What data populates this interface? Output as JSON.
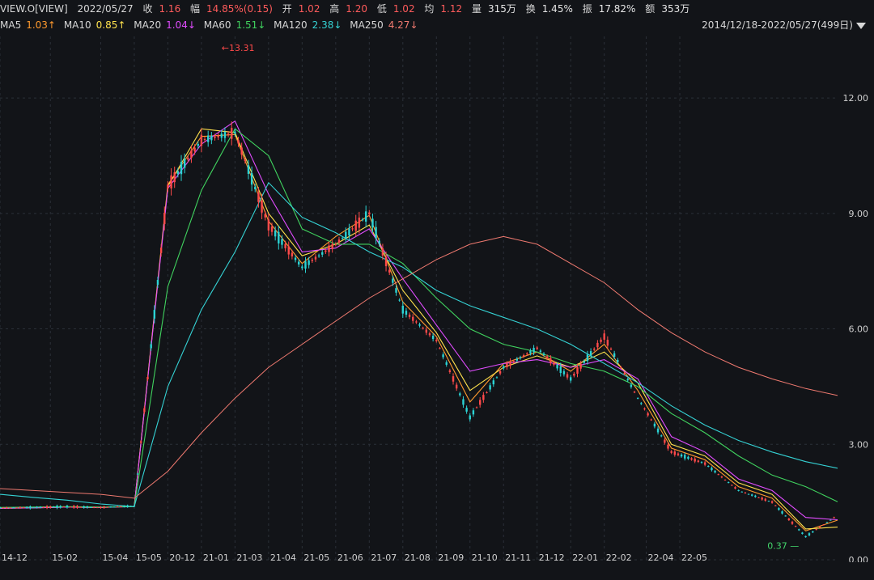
{
  "header": {
    "symbol": "VIEW.O[VIEW]",
    "date": "2022/05/27",
    "close_label": "收",
    "close": "1.16",
    "chg_label": "幅",
    "chg": "14.85%(0.15)",
    "open_label": "开",
    "open": "1.02",
    "high_label": "高",
    "high": "1.20",
    "low_label": "低",
    "low": "1.02",
    "avg_label": "均",
    "avg": "1.12",
    "vol_label": "量",
    "vol": "315万",
    "turn_label": "换",
    "turn": "1.45%",
    "amp_label": "振",
    "amp": "17.82%",
    "amt_label": "额",
    "amt": "353万"
  },
  "ma": {
    "ma5": {
      "label": "MA5",
      "value": "1.03↑",
      "color": "#ff9a2e"
    },
    "ma10": {
      "label": "MA10",
      "value": "0.85↑",
      "color": "#ffe24d"
    },
    "ma20": {
      "label": "MA20",
      "value": "1.04↓",
      "color": "#e14cff"
    },
    "ma60": {
      "label": "MA60",
      "value": "1.51↓",
      "color": "#40d35f"
    },
    "ma120": {
      "label": "MA120",
      "value": "2.38↓",
      "color": "#35d2d4"
    },
    "ma250": {
      "label": "MA250",
      "value": "4.27↓",
      "color": "#f07a70"
    }
  },
  "range_label": "2014/12/18-2022/05/27(499日)",
  "chart_data": {
    "type": "line",
    "title": "",
    "xlabel": "",
    "ylabel": "",
    "ylim": [
      0,
      13.6
    ],
    "grid": true,
    "y_ticks": [
      "0.00",
      "3.00",
      "6.00",
      "9.00",
      "12.00"
    ],
    "x_ticks": [
      "14-12",
      "15-02",
      "15-04",
      "15-05",
      "20-12",
      "21-01",
      "21-03",
      "21-04",
      "21-05",
      "21-06",
      "21-07",
      "21-08",
      "21-09",
      "21-10",
      "21-11",
      "21-12",
      "22-01",
      "22-02",
      "22-04",
      "22-05"
    ],
    "annotations": {
      "high": "13.31",
      "low": "0.37",
      "high_arrow": "←",
      "low_arrow": "—"
    },
    "series": [
      {
        "name": "Price",
        "x": [
          0,
          20,
          40,
          60,
          80,
          100,
          120,
          140,
          160,
          180,
          200,
          220,
          240,
          260,
          280,
          300,
          320,
          340,
          360,
          380,
          400,
          420,
          440,
          460,
          480,
          499
        ],
        "values": [
          1.35,
          1.36,
          1.38,
          1.36,
          1.4,
          9.7,
          10.9,
          11.1,
          8.7,
          7.6,
          8.2,
          9.0,
          6.5,
          5.7,
          3.7,
          5.0,
          5.5,
          4.7,
          5.8,
          4.2,
          2.8,
          2.5,
          1.8,
          1.5,
          0.6,
          1.16
        ]
      },
      {
        "name": "MA5",
        "values": [
          1.34,
          1.36,
          1.37,
          1.36,
          1.39,
          9.75,
          11.0,
          11.05,
          8.8,
          7.7,
          8.4,
          8.95,
          6.7,
          5.8,
          4.1,
          5.1,
          5.4,
          4.9,
          5.6,
          4.4,
          2.9,
          2.6,
          1.9,
          1.6,
          0.75,
          1.03
        ]
      },
      {
        "name": "MA10",
        "values": [
          1.34,
          1.35,
          1.37,
          1.36,
          1.39,
          9.7,
          11.2,
          11.1,
          9.0,
          7.9,
          8.2,
          8.7,
          7.0,
          5.9,
          4.4,
          5.0,
          5.3,
          5.0,
          5.4,
          4.6,
          3.0,
          2.7,
          2.0,
          1.7,
          0.8,
          0.85
        ]
      },
      {
        "name": "MA20",
        "values": [
          1.34,
          1.35,
          1.37,
          1.36,
          1.38,
          9.65,
          10.8,
          11.4,
          9.5,
          8.0,
          8.1,
          8.6,
          7.3,
          6.1,
          4.9,
          5.1,
          5.2,
          5.0,
          5.2,
          4.7,
          3.2,
          2.8,
          2.1,
          1.8,
          1.1,
          1.04
        ]
      },
      {
        "name": "MA60",
        "values": [
          1.36,
          1.37,
          1.38,
          1.37,
          1.38,
          7.1,
          9.6,
          11.2,
          10.5,
          8.6,
          8.2,
          8.2,
          7.7,
          6.8,
          6.0,
          5.6,
          5.4,
          5.1,
          4.9,
          4.5,
          3.8,
          3.3,
          2.7,
          2.2,
          1.9,
          1.51
        ]
      },
      {
        "name": "MA120",
        "values": [
          1.7,
          1.62,
          1.55,
          1.45,
          1.38,
          4.5,
          6.5,
          8.0,
          9.8,
          8.9,
          8.5,
          8.0,
          7.6,
          7.0,
          6.6,
          6.3,
          6.0,
          5.6,
          5.1,
          4.6,
          4.0,
          3.5,
          3.1,
          2.8,
          2.55,
          2.38
        ]
      },
      {
        "name": "MA250",
        "values": [
          1.85,
          1.8,
          1.75,
          1.7,
          1.6,
          2.3,
          3.3,
          4.2,
          5.0,
          5.6,
          6.2,
          6.8,
          7.3,
          7.8,
          8.2,
          8.4,
          8.2,
          7.7,
          7.2,
          6.5,
          5.9,
          5.4,
          5.0,
          4.7,
          4.45,
          4.27
        ]
      }
    ]
  }
}
